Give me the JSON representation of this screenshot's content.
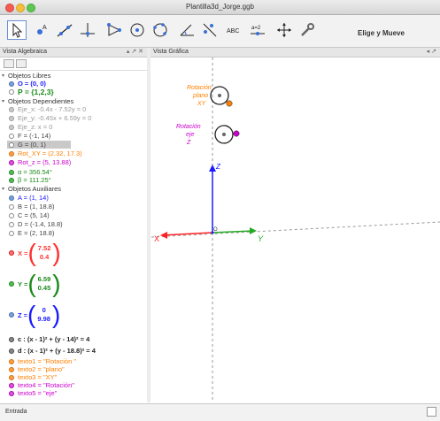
{
  "window": {
    "title": "Plantilla3d_Jorge.ggb"
  },
  "toolbar": {
    "tools": [
      {
        "icon": "move-arrow-icon"
      },
      {
        "icon": "point-icon"
      },
      {
        "icon": "line-icon"
      },
      {
        "icon": "perpendicular-icon"
      },
      {
        "icon": "polygon-icon"
      },
      {
        "icon": "circle-icon"
      },
      {
        "icon": "circle-three-points-icon"
      },
      {
        "icon": "angle-icon"
      },
      {
        "icon": "reflect-icon"
      },
      {
        "icon": "text-icon",
        "text": "ABC"
      },
      {
        "icon": "slider-icon",
        "text": "a=2"
      },
      {
        "icon": "move-view-icon"
      },
      {
        "icon": "settings-icon"
      }
    ],
    "mode_label": "Elige y Mueve"
  },
  "views": {
    "algebra_label": "Vista Algebraica",
    "graphics_label": "Vista Gráfica",
    "controls": "▴ ↗ ✕"
  },
  "algebra": {
    "free_header": "Objetos Libres",
    "free": [
      {
        "text": "O = (0, 0)",
        "color": "#1a1aff"
      },
      {
        "text": "P = {1,2,3}",
        "color": "#1a8a1a"
      }
    ],
    "dep_header": "Objetos Dependientes",
    "dep": [
      {
        "text": "Eje_x: -0.4x - 7.52y = 0",
        "color": "#9a9a9a"
      },
      {
        "text": "Eje_y: -0.45x + 6.59y = 0",
        "color": "#9a9a9a"
      },
      {
        "text": "Eje_z: x = 0",
        "color": "#9a9a9a"
      },
      {
        "text": "F = (-1, 14)",
        "color": "#444444"
      },
      {
        "text": "G = (0, 1)",
        "color": "#444444"
      },
      {
        "text": "Rot_XY = (2.32, 17.3)",
        "color": "#ff7f00"
      },
      {
        "text": "Rot_z = (5, 13.88)",
        "color": "#cc00cc"
      },
      {
        "text": "α = 356.54°",
        "color": "#1a8a1a"
      },
      {
        "text": "β = 111.25°",
        "color": "#1a8a1a"
      }
    ],
    "aux_header": "Objetos Auxiliares",
    "aux": [
      {
        "text": "A = (1, 14)",
        "color": "#1a1aff"
      },
      {
        "text": "B = (1, 18.8)",
        "color": "#444444"
      },
      {
        "text": "C = (5, 14)",
        "color": "#444444"
      },
      {
        "text": "D = (-1.4, 18.8)",
        "color": "#444444"
      },
      {
        "text": "E = (2, 18.8)",
        "color": "#444444"
      }
    ],
    "vectors": [
      {
        "name": "X =",
        "top": "7.52",
        "bottom": "0.4",
        "color": "#ff3030"
      },
      {
        "name": "Y =",
        "top": "6.59",
        "bottom": "0.45",
        "color": "#1a8a1a"
      },
      {
        "name": "Z =",
        "top": "0",
        "bottom": "9.98",
        "color": "#1a1aff"
      }
    ],
    "circles": [
      {
        "text": "c : (x - 1)² + (y - 14)² = 4",
        "color": "#222222"
      },
      {
        "text": "d : (x - 1)² + (y - 18.8)² = 4",
        "color": "#222222"
      }
    ],
    "texts": [
      {
        "text": "texto1 = \"Rotación \"",
        "color": "#ff7f00"
      },
      {
        "text": "texto2 = \"plano\"",
        "color": "#ff7f00"
      },
      {
        "text": "texto3 = \"XY\"",
        "color": "#ff7f00"
      },
      {
        "text": "texto4 = \"Rotación\"",
        "color": "#cc00cc"
      },
      {
        "text": "texto5 = \"eje\"",
        "color": "#cc00cc"
      }
    ]
  },
  "graphics": {
    "label_rot_xy": [
      "Rotación",
      "plano",
      "XY"
    ],
    "label_rot_z": [
      "Rotación",
      "eje",
      "Z"
    ],
    "axis_x": "X",
    "axis_y": "Y",
    "axis_z": "Z",
    "origin": "O",
    "colors": {
      "x_axis": "#ff2020",
      "y_axis": "#22aa22",
      "z_axis": "#1a1aff",
      "orange": "#ff7f00",
      "magenta": "#cc00cc"
    }
  },
  "input": {
    "label": "Entrada"
  }
}
